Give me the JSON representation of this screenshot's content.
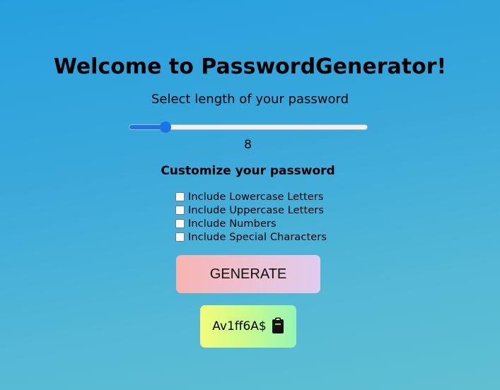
{
  "header": {
    "title": "Welcome to PasswordGenerator!",
    "subtitle": "Select length of your password"
  },
  "length_slider": {
    "value": "8",
    "fraction": 0.155
  },
  "customize": {
    "heading": "Customize your password",
    "options": [
      {
        "label": "Include Lowercase Letters",
        "checked": false
      },
      {
        "label": "Include Uppercase Letters",
        "checked": false
      },
      {
        "label": "Include Numbers",
        "checked": false
      },
      {
        "label": "Include Special Characters",
        "checked": false
      }
    ]
  },
  "generate_button": {
    "label": "GENERATE"
  },
  "result": {
    "password": "Av1ff6A$",
    "icon": "clipboard-icon"
  }
}
